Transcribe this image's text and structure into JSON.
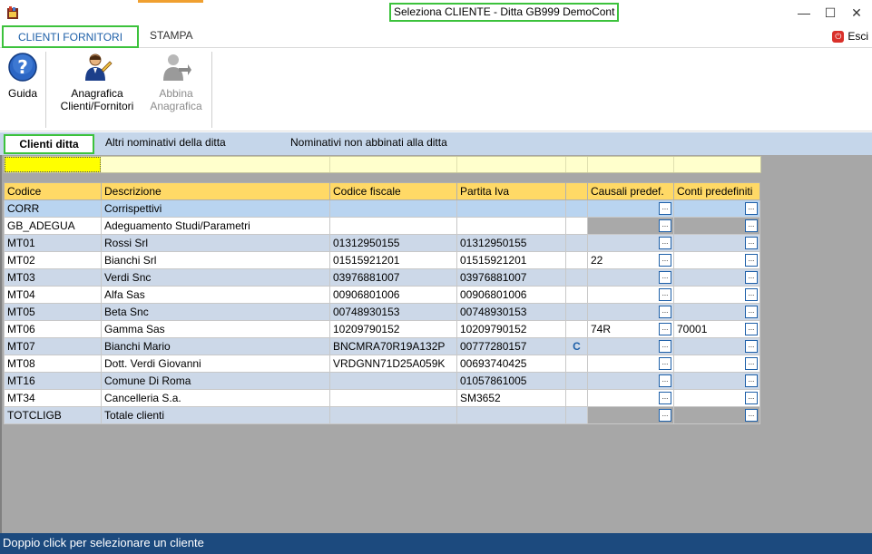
{
  "window": {
    "title": "Seleziona CLIENTE  - Ditta GB999 DemoCont",
    "minimize": "—",
    "maximize": "☐",
    "close": "✕"
  },
  "ribbon_tabs": {
    "clienti_fornitori": "CLIENTI FORNITORI",
    "stampa": "STAMPA",
    "esci": "Esci"
  },
  "ribbon": {
    "guida": "Guida",
    "anagrafica_line1": "Anagrafica",
    "anagrafica_line2": "Clienti/Fornitori",
    "abbina_line1": "Abbina",
    "abbina_line2": "Anagrafica"
  },
  "sub_tabs": {
    "clienti_ditta": "Clienti ditta",
    "altri_nominativi": "Altri nominativi della ditta",
    "non_abbinati": "Nominativi non abbinati alla ditta"
  },
  "grid": {
    "columns": [
      "Codice",
      "Descrizione",
      "Codice fiscale",
      "Partita Iva",
      "",
      "Causali predef.",
      "Conti predefiniti"
    ],
    "ellipsis_label": "...",
    "rows": [
      {
        "codice": "CORR",
        "descrizione": "Corrispettivi",
        "cf": "",
        "piva": "",
        "flag": "",
        "causali": "",
        "conti": "",
        "gray": false,
        "style": "sel"
      },
      {
        "codice": "GB_ADEGUA",
        "descrizione": "Adeguamento Studi/Parametri",
        "cf": "",
        "piva": "",
        "flag": "",
        "causali": "",
        "conti": "",
        "gray": true,
        "style": "even"
      },
      {
        "codice": "MT01",
        "descrizione": "Rossi Srl",
        "cf": "01312950155",
        "piva": "01312950155",
        "flag": "",
        "causali": "",
        "conti": "",
        "gray": false,
        "style": "odd"
      },
      {
        "codice": "MT02",
        "descrizione": "Bianchi Srl",
        "cf": "01515921201",
        "piva": "01515921201",
        "flag": "",
        "causali": "22",
        "conti": "",
        "gray": false,
        "style": "even"
      },
      {
        "codice": "MT03",
        "descrizione": "Verdi Snc",
        "cf": "03976881007",
        "piva": "03976881007",
        "flag": "",
        "causali": "",
        "conti": "",
        "gray": false,
        "style": "odd"
      },
      {
        "codice": "MT04",
        "descrizione": "Alfa Sas",
        "cf": "00906801006",
        "piva": "00906801006",
        "flag": "",
        "causali": "",
        "conti": "",
        "gray": false,
        "style": "even"
      },
      {
        "codice": "MT05",
        "descrizione": "Beta Snc",
        "cf": "00748930153",
        "piva": "00748930153",
        "flag": "",
        "causali": "",
        "conti": "",
        "gray": false,
        "style": "odd"
      },
      {
        "codice": "MT06",
        "descrizione": "Gamma Sas",
        "cf": "10209790152",
        "piva": "10209790152",
        "flag": "",
        "causali": "74R",
        "conti": "70001",
        "gray": false,
        "style": "even"
      },
      {
        "codice": "MT07",
        "descrizione": "Bianchi Mario",
        "cf": "BNCMRA70R19A132P",
        "piva": "00777280157",
        "flag": "C",
        "causali": "",
        "conti": "",
        "gray": false,
        "style": "odd"
      },
      {
        "codice": "MT08",
        "descrizione": "Dott. Verdi Giovanni",
        "cf": "VRDGNN71D25A059K",
        "piva": "00693740425",
        "flag": "",
        "causali": "",
        "conti": "",
        "gray": false,
        "style": "even"
      },
      {
        "codice": "MT16",
        "descrizione": "Comune Di Roma",
        "cf": "",
        "piva": "01057861005",
        "flag": "",
        "causali": "",
        "conti": "",
        "gray": false,
        "style": "odd"
      },
      {
        "codice": "MT34",
        "descrizione": "Cancelleria S.a.",
        "cf": "",
        "piva": "SM3652",
        "flag": "",
        "causali": "",
        "conti": "",
        "gray": false,
        "style": "even"
      },
      {
        "codice": "TOTCLIGB",
        "descrizione": "Totale clienti",
        "cf": "",
        "piva": "",
        "flag": "",
        "causali": "",
        "conti": "",
        "gray": true,
        "style": "odd"
      }
    ]
  },
  "status": {
    "text": "Doppio click per selezionare un cliente"
  }
}
